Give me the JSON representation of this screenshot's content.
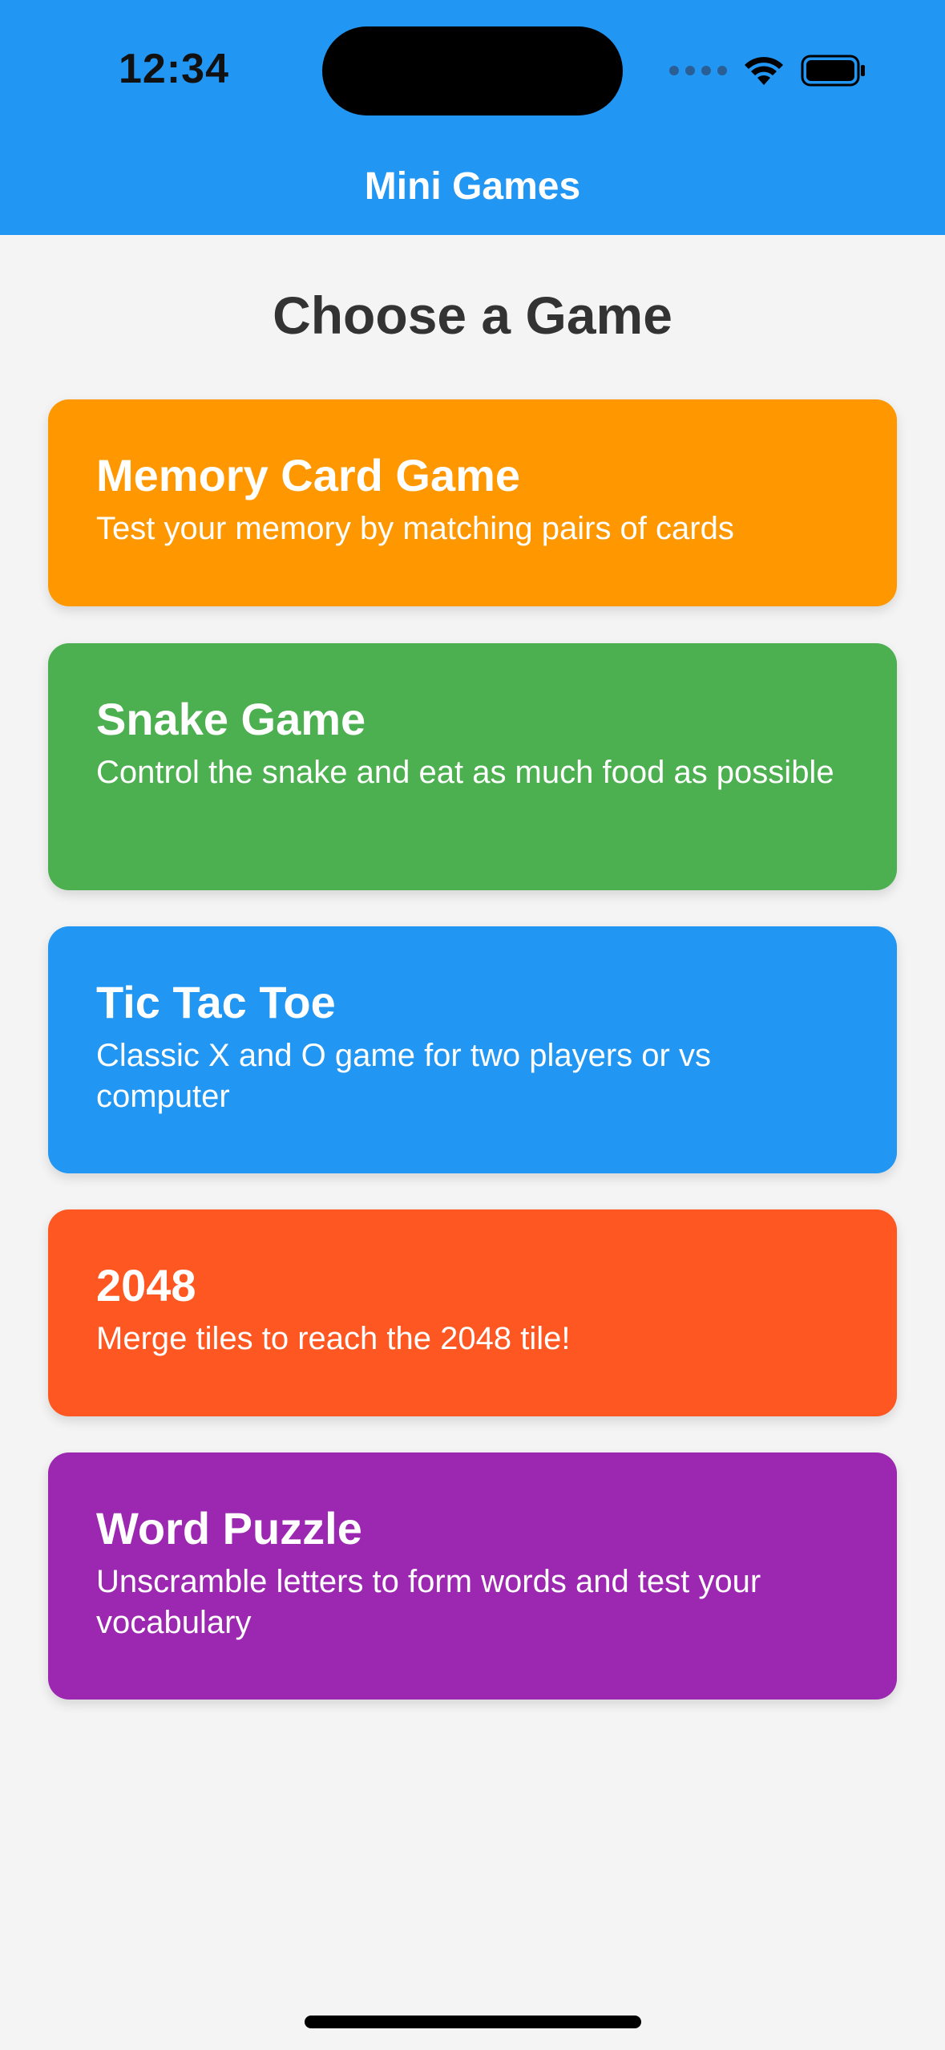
{
  "status_bar": {
    "time": "12:34"
  },
  "header": {
    "title": "Mini Games",
    "color": "#2196F3"
  },
  "main": {
    "heading": "Choose a Game",
    "games": [
      {
        "title": "Memory Card Game",
        "description": "Test your memory by matching pairs of cards",
        "color": "#FF9800"
      },
      {
        "title": "Snake Game",
        "description": "Control the snake and eat as much food as possible",
        "color": "#4CAF50"
      },
      {
        "title": "Tic Tac Toe",
        "description": "Classic X and O game for two players or vs computer",
        "color": "#2196F3"
      },
      {
        "title": "2048",
        "description": "Merge tiles to reach the 2048 tile!",
        "color": "#FF5722"
      },
      {
        "title": "Word Puzzle",
        "description": "Unscramble letters to form words and test your vocabulary",
        "color": "#9C27B0"
      }
    ]
  },
  "icons": {
    "signal": "cellular-signal-icon",
    "wifi": "wifi-icon",
    "battery": "battery-icon"
  }
}
